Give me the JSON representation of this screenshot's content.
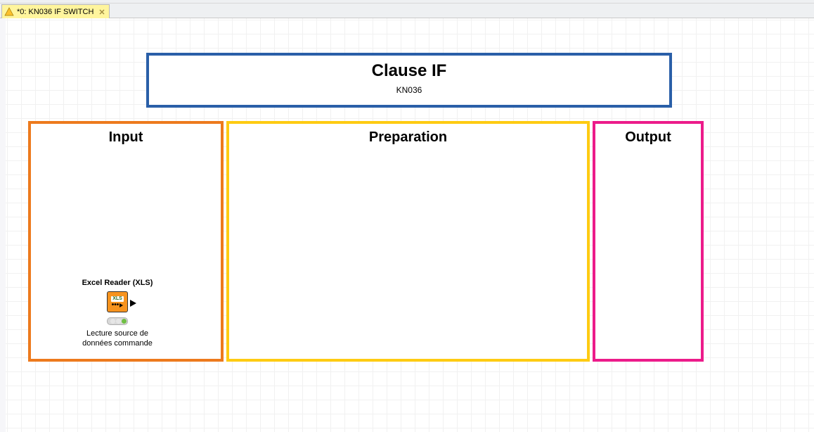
{
  "tab": {
    "label": "*0: KN036 IF SWITCH"
  },
  "title": {
    "main": "Clause IF",
    "sub": "KN036"
  },
  "sections": {
    "input": "Input",
    "preparation": "Preparation",
    "output": "Output"
  },
  "node": {
    "title": "Excel Reader (XLS)",
    "xls_label": "XLS",
    "dots": "•••",
    "description": "Lecture source de\ndonnées commande"
  }
}
